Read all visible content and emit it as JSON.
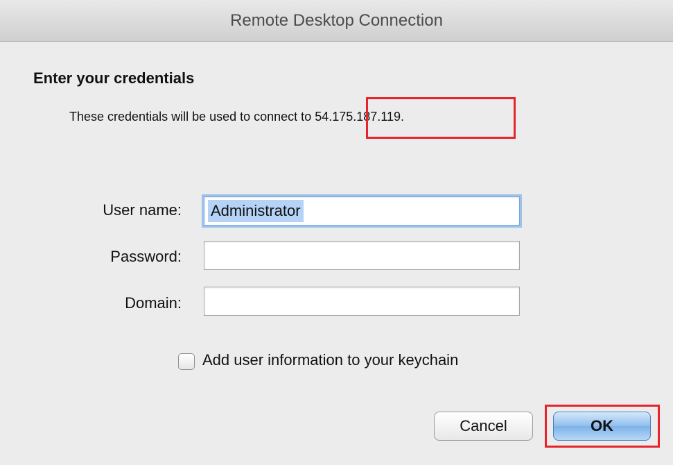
{
  "window": {
    "title": "Remote Desktop Connection"
  },
  "dialog": {
    "heading": "Enter your credentials",
    "description_prefix": "These credentials will be used to connect to ",
    "host": "54.175.187.119."
  },
  "fields": {
    "username": {
      "label": "User name:",
      "value": "Administrator"
    },
    "password": {
      "label": "Password:",
      "value": ""
    },
    "domain": {
      "label": "Domain:",
      "value": ""
    }
  },
  "keychain": {
    "label": "Add user information to your keychain",
    "checked": false
  },
  "buttons": {
    "cancel": "Cancel",
    "ok": "OK"
  },
  "colors": {
    "highlight": "#e5242b",
    "selection": "#b5d3f7",
    "focus_ring": "#9cc3ee",
    "default_button": "#7db2e8"
  }
}
